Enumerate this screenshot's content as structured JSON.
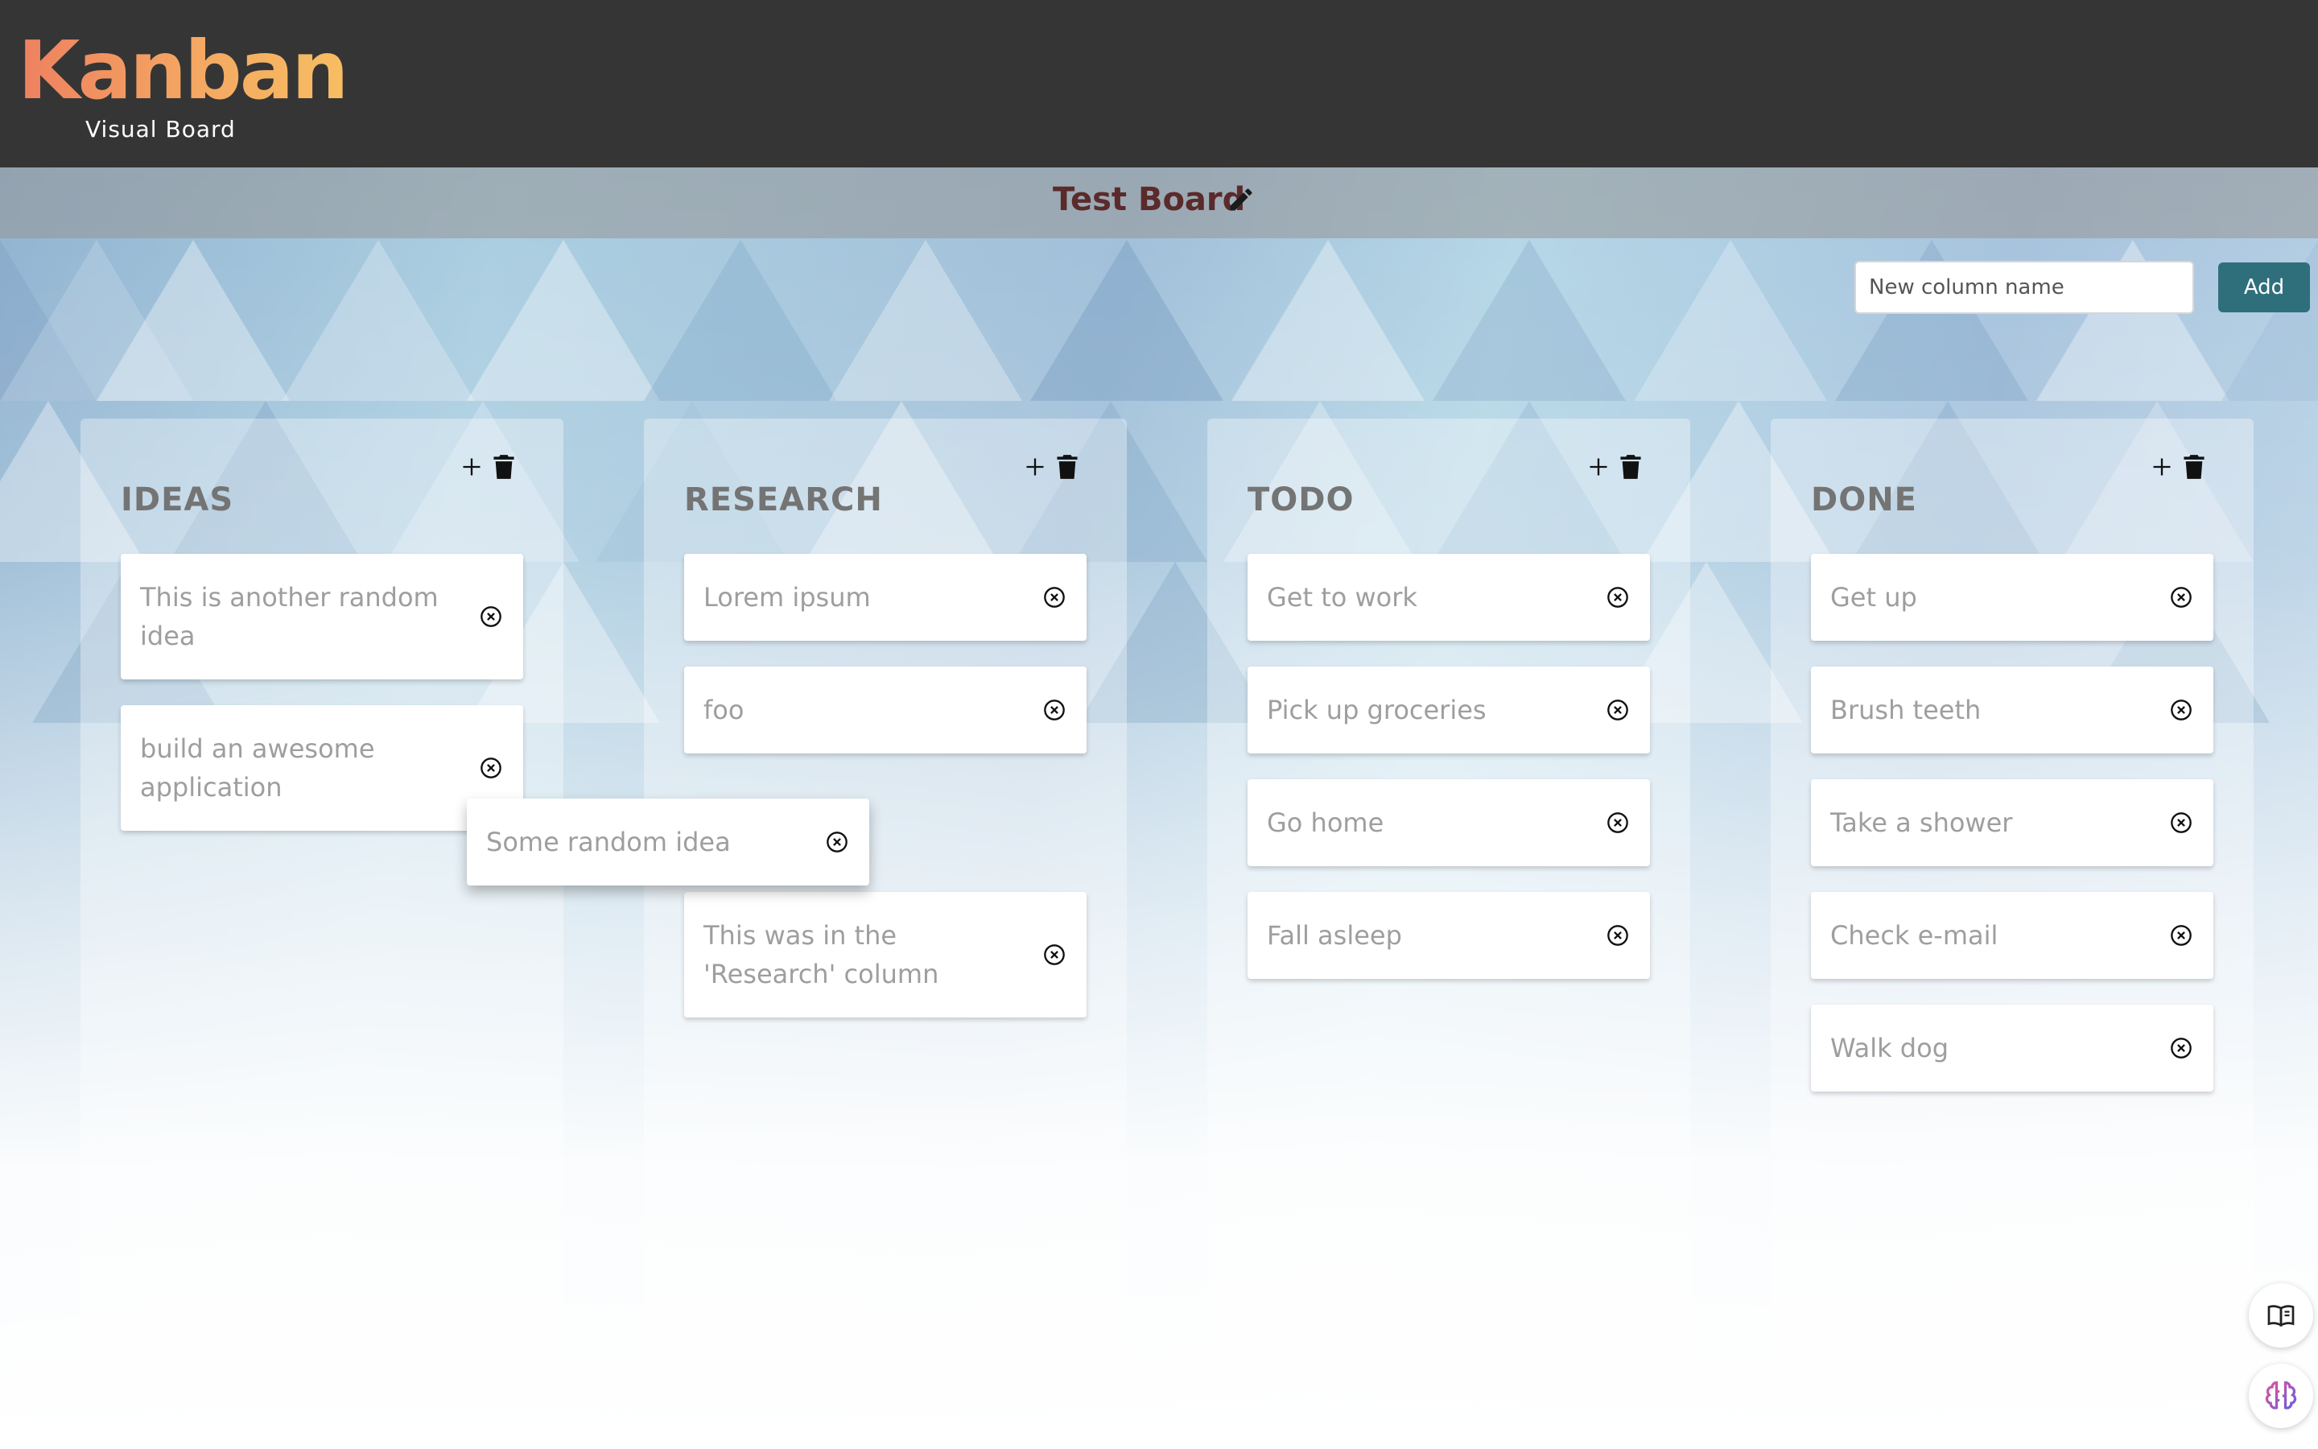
{
  "header": {
    "logo": "Kanban",
    "subtitle": "Visual Board"
  },
  "board": {
    "title": "Test Board"
  },
  "new_column": {
    "placeholder": "New column name",
    "add_label": "Add"
  },
  "columns": [
    {
      "name": "IDEAS",
      "cards": [
        "This is another random idea",
        "build an awesome application"
      ]
    },
    {
      "name": "RESEARCH",
      "cards": [
        "Lorem ipsum",
        "foo",
        "This was in the 'Research' column"
      ]
    },
    {
      "name": "TODO",
      "cards": [
        "Get to work",
        "Pick up groceries",
        "Go home",
        "Fall asleep"
      ]
    },
    {
      "name": "DONE",
      "cards": [
        "Get up",
        "Brush teeth",
        "Take a shower",
        "Check e-mail",
        "Walk dog"
      ]
    }
  ],
  "dragging_card": {
    "text": "Some random idea"
  },
  "colors": {
    "header_bg": "#353535",
    "logo_gradient_start": "#ee8060",
    "logo_gradient_end": "#f7be63",
    "board_title": "#5b2a2a",
    "add_button": "#2f6f7c",
    "card_text": "#9e9e9e",
    "column_title": "#747474"
  },
  "icons": [
    "pencil-icon",
    "plus-icon",
    "trash-icon",
    "close-circle-icon",
    "book-icon",
    "brain-icon"
  ]
}
